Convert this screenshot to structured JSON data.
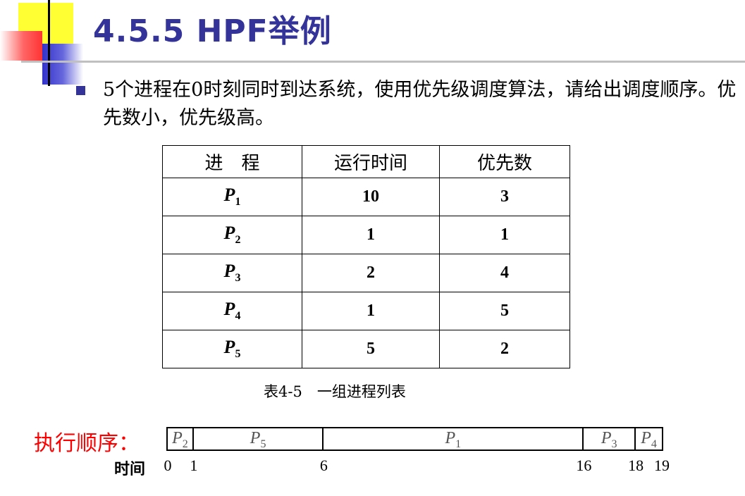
{
  "slide": {
    "title": "4.5.5  HPF举例",
    "bullet": "5个进程在0时刻同时到达系统，使用优先级调度算法，请给出调度顺序。优先数小，优先级高。"
  },
  "table": {
    "headers": [
      "进　程",
      "运行时间",
      "优先数"
    ],
    "rows": [
      {
        "name": "P",
        "sub": "1",
        "run_time": "10",
        "priority": "3"
      },
      {
        "name": "P",
        "sub": "2",
        "run_time": "1",
        "priority": "1"
      },
      {
        "name": "P",
        "sub": "3",
        "run_time": "2",
        "priority": "4"
      },
      {
        "name": "P",
        "sub": "4",
        "run_time": "1",
        "priority": "5"
      },
      {
        "name": "P",
        "sub": "5",
        "run_time": "5",
        "priority": "2"
      }
    ],
    "caption": "表4-5　一组进程列表"
  },
  "gantt": {
    "label": "执行顺序：",
    "time_label": "时间",
    "segments": [
      {
        "name": "P",
        "sub": "2",
        "start": 0,
        "end": 1
      },
      {
        "name": "P",
        "sub": "5",
        "start": 1,
        "end": 6
      },
      {
        "name": "P",
        "sub": "1",
        "start": 6,
        "end": 16
      },
      {
        "name": "P",
        "sub": "3",
        "start": 16,
        "end": 18
      },
      {
        "name": "P",
        "sub": "4",
        "start": 18,
        "end": 19
      }
    ],
    "ticks": [
      "0",
      "1",
      "6",
      "16",
      "18",
      "19"
    ]
  },
  "colors": {
    "title": "#333399",
    "bullet": "#333399",
    "exec_label": "#ff0000"
  }
}
